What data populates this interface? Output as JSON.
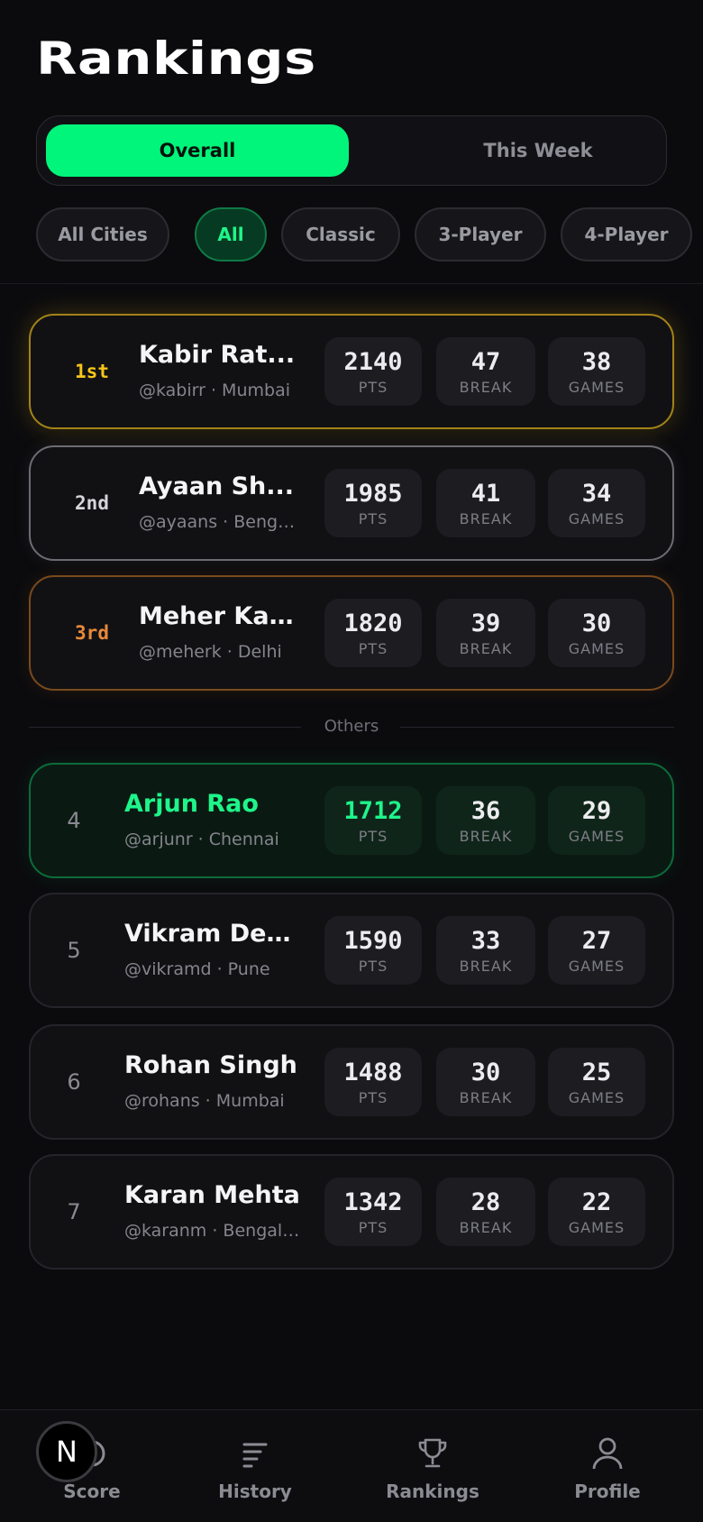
{
  "page": {
    "title": "Rankings"
  },
  "segment": {
    "active": "Overall",
    "inactive": "This Week"
  },
  "filters": [
    "All Cities",
    "All",
    "Classic",
    "3-Player",
    "4-Player"
  ],
  "divider_label": "Others",
  "stat_labels": {
    "pts": "PTS",
    "break": "BREAK",
    "games": "GAMES"
  },
  "colors": {
    "accent": "#00f57a",
    "gold": "#f5c518",
    "silver": "#d6d6da",
    "bronze": "#e8893a"
  },
  "players": [
    {
      "rank": "1st",
      "name": "Kabir Rat...",
      "handle": "@kabirr · Mumbai",
      "pts": "2140",
      "break": "47",
      "games": "38"
    },
    {
      "rank": "2nd",
      "name": "Ayaan Sh...",
      "handle": "@ayaans · Benga...",
      "pts": "1985",
      "break": "41",
      "games": "34"
    },
    {
      "rank": "3rd",
      "name": "Meher Ka...",
      "handle": "@meherk · Delhi",
      "pts": "1820",
      "break": "39",
      "games": "30"
    },
    {
      "rank": "4",
      "name": "Arjun Rao",
      "handle": "@arjunr · Chennai",
      "pts": "1712",
      "break": "36",
      "games": "29"
    },
    {
      "rank": "5",
      "name": "Vikram Desai",
      "handle": "@vikramd · Pune",
      "pts": "1590",
      "break": "33",
      "games": "27"
    },
    {
      "rank": "6",
      "name": "Rohan Singh",
      "handle": "@rohans · Mumbai",
      "pts": "1488",
      "break": "30",
      "games": "25"
    },
    {
      "rank": "7",
      "name": "Karan Mehta",
      "handle": "@karanm · Bengaluru",
      "pts": "1342",
      "break": "28",
      "games": "22"
    }
  ],
  "tabs": [
    {
      "label": "Score",
      "icon": "score-icon"
    },
    {
      "label": "History",
      "icon": "history-icon"
    },
    {
      "label": "Rankings",
      "icon": "trophy-icon"
    },
    {
      "label": "Profile",
      "icon": "profile-icon"
    }
  ],
  "badge": {
    "letter": "N"
  }
}
